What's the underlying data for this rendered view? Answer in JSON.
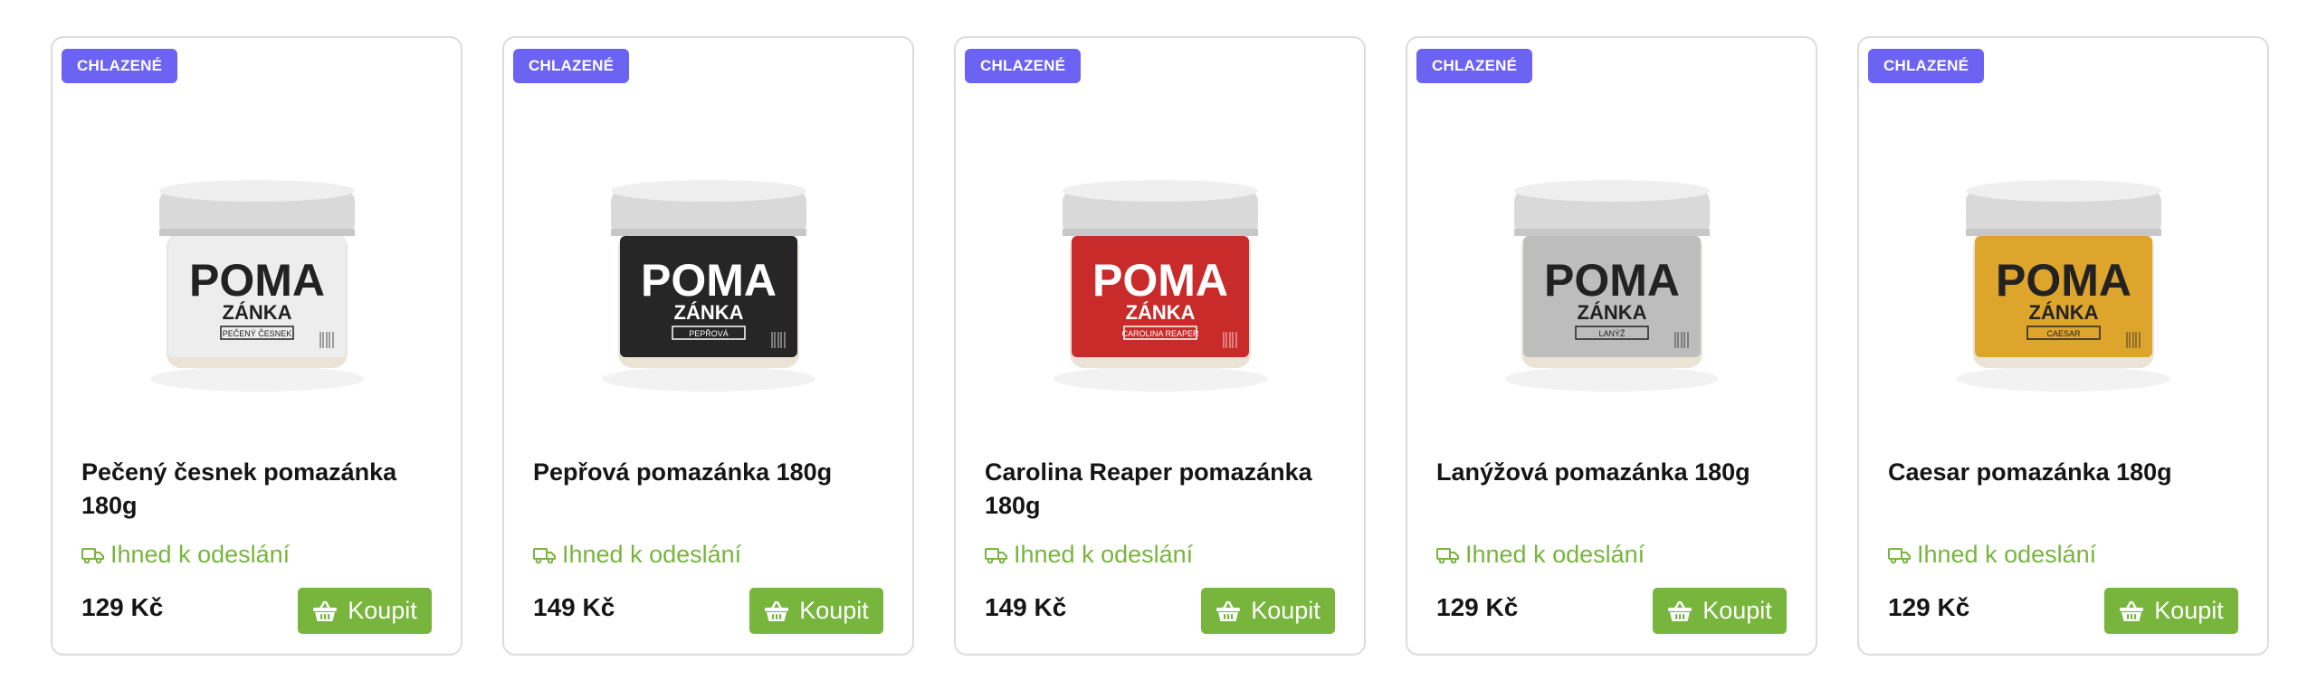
{
  "colors": {
    "badge": "#6c63f2",
    "accent_green": "#77b53c",
    "border": "#dcdcdc",
    "text": "#151515"
  },
  "icons": {
    "availability": "truck-icon",
    "buy": "basket-icon"
  },
  "products": [
    {
      "badge": "CHLAZENÉ",
      "title": "Pečený česnek pomazánka 180g",
      "availability": "Ihned k odeslání",
      "price": "129 Kč",
      "buy_label": "Koupit",
      "jar_color": "#ededed",
      "jar_text_color": "#222222",
      "jar_brand_top": "POMA",
      "jar_brand_bottom": "ZÁNKA",
      "jar_flavor": "PEČENÝ ČESNEK"
    },
    {
      "badge": "CHLAZENÉ",
      "title": "Pepřová pomazánka 180g",
      "availability": "Ihned k odeslání",
      "price": "149 Kč",
      "buy_label": "Koupit",
      "jar_color": "#262626",
      "jar_text_color": "#ffffff",
      "jar_brand_top": "POMA",
      "jar_brand_bottom": "ZÁNKA",
      "jar_flavor": "PEPŘOVÁ"
    },
    {
      "badge": "CHLAZENÉ",
      "title": "Carolina Reaper pomazánka 180g",
      "availability": "Ihned k odeslání",
      "price": "149 Kč",
      "buy_label": "Koupit",
      "jar_color": "#c92a2a",
      "jar_text_color": "#ffffff",
      "jar_brand_top": "POMA",
      "jar_brand_bottom": "ZÁNKA",
      "jar_flavor": "CAROLINA REAPER"
    },
    {
      "badge": "CHLAZENÉ",
      "title": "Lanýžová pomazánka 180g",
      "availability": "Ihned k odeslání",
      "price": "129 Kč",
      "buy_label": "Koupit",
      "jar_color": "#bdbdbd",
      "jar_text_color": "#222222",
      "jar_brand_top": "POMA",
      "jar_brand_bottom": "ZÁNKA",
      "jar_flavor": "LANÝŽ"
    },
    {
      "badge": "CHLAZENÉ",
      "title": "Caesar pomazánka 180g",
      "availability": "Ihned k odeslání",
      "price": "129 Kč",
      "buy_label": "Koupit",
      "jar_color": "#dda52c",
      "jar_text_color": "#222222",
      "jar_brand_top": "POMA",
      "jar_brand_bottom": "ZÁNKA",
      "jar_flavor": "CAESAR"
    }
  ]
}
